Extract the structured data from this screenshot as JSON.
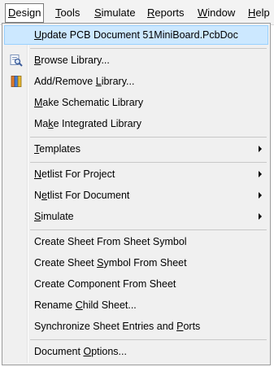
{
  "menubar": {
    "items": [
      {
        "pre": "",
        "mn": "D",
        "post": "esign"
      },
      {
        "pre": "",
        "mn": "T",
        "post": "ools"
      },
      {
        "pre": "",
        "mn": "S",
        "post": "imulate"
      },
      {
        "pre": "",
        "mn": "R",
        "post": "eports"
      },
      {
        "pre": "",
        "mn": "W",
        "post": "indow"
      },
      {
        "pre": "",
        "mn": "H",
        "post": "elp"
      }
    ]
  },
  "menu": {
    "items": [
      {
        "pre": "",
        "mn": "U",
        "post": "pdate PCB Document 51MiniBoard.PcbDoc",
        "icon": ""
      },
      {
        "pre": "",
        "mn": "B",
        "post": "rowse Library...",
        "icon": "browse-library-icon"
      },
      {
        "pre": "Add/Remove ",
        "mn": "L",
        "post": "ibrary...",
        "icon": "add-remove-library-icon"
      },
      {
        "pre": "",
        "mn": "M",
        "post": "ake Schematic Library",
        "icon": ""
      },
      {
        "pre": "Ma",
        "mn": "k",
        "post": "e Integrated Library",
        "icon": ""
      },
      {
        "pre": "",
        "mn": "T",
        "post": "emplates",
        "icon": ""
      },
      {
        "pre": "",
        "mn": "N",
        "post": "etlist For Project",
        "icon": ""
      },
      {
        "pre": "N",
        "mn": "e",
        "post": "tlist For Document",
        "icon": ""
      },
      {
        "pre": "",
        "mn": "S",
        "post": "imulate",
        "icon": ""
      },
      {
        "pre": "Create Sheet From Sheet Symbol",
        "mn": "",
        "post": "",
        "icon": ""
      },
      {
        "pre": "Create Sheet ",
        "mn": "S",
        "post": "ymbol From Sheet",
        "icon": ""
      },
      {
        "pre": "Create Component From Sheet",
        "mn": "",
        "post": "",
        "icon": ""
      },
      {
        "pre": "Rename ",
        "mn": "C",
        "post": "hild Sheet...",
        "icon": ""
      },
      {
        "pre": "Synchronize Sheet Entries and ",
        "mn": "P",
        "post": "orts",
        "icon": ""
      },
      {
        "pre": "Document ",
        "mn": "O",
        "post": "ptions...",
        "icon": ""
      }
    ]
  }
}
